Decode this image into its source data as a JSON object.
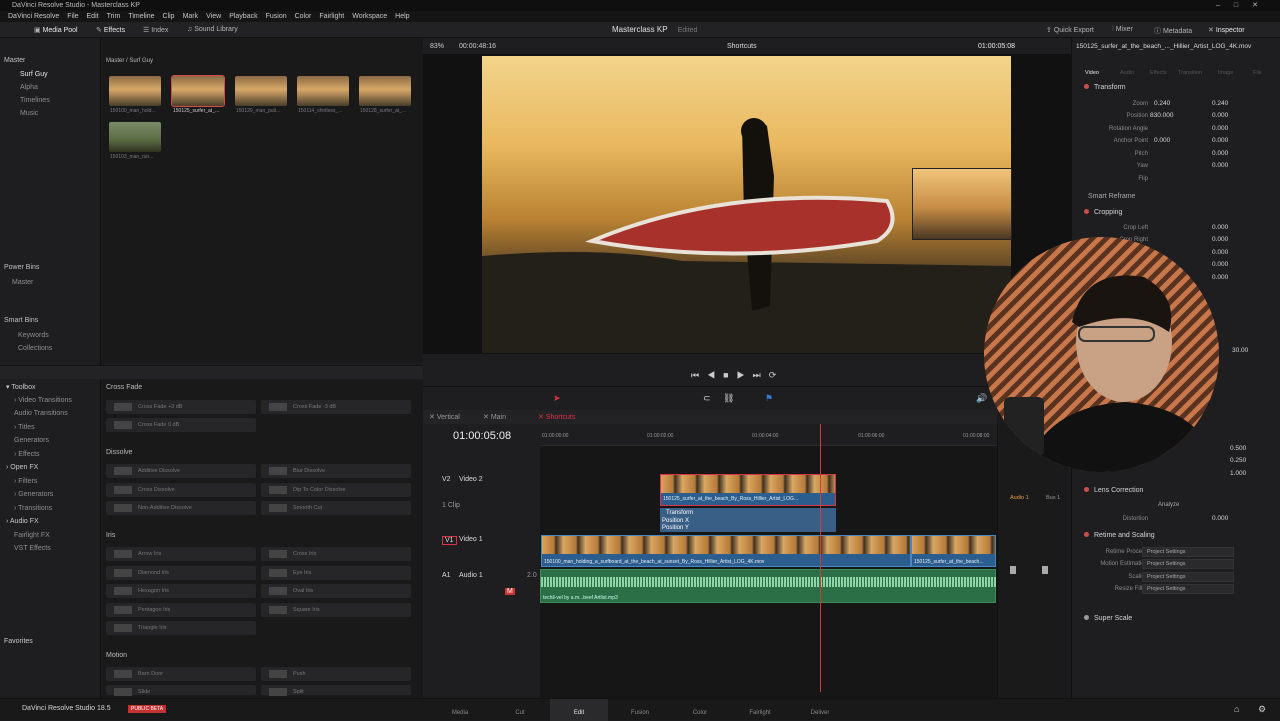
{
  "window": {
    "title": "DaVinci Resolve Studio - Masterclass KP"
  },
  "menu": [
    "DaVinci Resolve",
    "File",
    "Edit",
    "Trim",
    "Timeline",
    "Clip",
    "Mark",
    "View",
    "Playback",
    "Fusion",
    "Color",
    "Fairlight",
    "Workspace",
    "Help"
  ],
  "toolbar": {
    "media_pool": "Media Pool",
    "effects": "Effects",
    "index": "Index",
    "sound_library": "Sound Library",
    "project": "Masterclass KP",
    "status": "Edited",
    "quick_export": "Quick Export",
    "mixer": "Mixer",
    "metadata": "Metadata",
    "inspector": "Inspector"
  },
  "bins": {
    "master": "Master",
    "surf_guy": "Surf Guy",
    "alpha": "Alpha",
    "timelines": "Timelines",
    "music": "Music",
    "power_bins": "Power Bins",
    "power_master": "Master",
    "smart_bins": "Smart Bins",
    "keywords": "Keywords",
    "collections": "Collections"
  },
  "pool": {
    "path": "Master / Surf Guy",
    "clips": [
      "150100_man_hold...",
      "150125_surfer_at_...",
      "150129_man_putt...",
      "150114_shirtless_...",
      "150128_surfer_at_...",
      "150103_man_run..."
    ]
  },
  "effects_tree": {
    "toolbox": "Toolbox",
    "video_transitions": "Video Transitions",
    "audio_transitions": "Audio Transitions",
    "titles": "Titles",
    "generators": "Generators",
    "effects": "Effects",
    "open_fx": "Open FX",
    "filters": "Filters",
    "ofx_generators": "Generators",
    "transitions": "Transitions",
    "audio_fx": "Audio FX",
    "fairlight_fx": "Fairlight FX",
    "vst_effects": "VST Effects",
    "favorites": "Favorites"
  },
  "effects_list": {
    "cross_fade": "Cross Fade",
    "cf1": "Cross Fade +3 dB",
    "cf2": "Cross Fade -3 dB",
    "cf3": "Cross Fade 0 dB",
    "dissolve": "Dissolve",
    "d1": "Additive Dissolve",
    "d2": "Blur Dissolve",
    "d3": "Cross Dissolve",
    "d4": "Dip To Color Dissolve",
    "d5": "Non-Additive Dissolve",
    "d6": "Smooth Cut",
    "iris": "Iris",
    "i1": "Arrow Iris",
    "i2": "Cross Iris",
    "i3": "Diamond Iris",
    "i4": "Eye Iris",
    "i5": "Hexagon Iris",
    "i6": "Oval Iris",
    "i7": "Pentagon Iris",
    "i8": "Square Iris",
    "i9": "Triangle Iris",
    "motion": "Motion",
    "m1": "Barn Door",
    "m2": "Push",
    "m3": "Slide",
    "m4": "Split"
  },
  "viewer": {
    "zoom": "83%",
    "duration": "00:00:48:16",
    "mode": "Shortcuts",
    "timecode": "01:00:05:08"
  },
  "inspector": {
    "clip_name": "150125_surfer_at_the_beach_..._Hillier_Artist_LOG_4K.mov",
    "tabs": [
      "Video",
      "Audio",
      "Effects",
      "Transition",
      "Image",
      "File"
    ],
    "transform": "Transform",
    "zoom_label": "Zoom",
    "zoom_x": "0.240",
    "zoom_y": "0.240",
    "position_label": "Position",
    "pos_x": "830.000",
    "pos_y": "0.000",
    "rotation_label": "Rotation Angle",
    "rotation": "0.000",
    "anchor_label": "Anchor Point",
    "anchor_x": "0.000",
    "anchor_y": "0.000",
    "pitch_label": "Pitch",
    "pitch": "0.000",
    "yaw_label": "Yaw",
    "yaw": "0.000",
    "flip_label": "Flip",
    "smart_reframe": "Smart Reframe",
    "cropping": "Cropping",
    "crop_left_label": "Crop Left",
    "crop_left": "0.000",
    "crop_right_label": "Crop Right",
    "crop_right": "0.000",
    "crop_v3": "0.000",
    "crop_v4": "0.000",
    "crop_v5": "0.000",
    "v30": "30.00",
    "v500": "0.500",
    "v250": "0.250",
    "v1000": "1.000",
    "lens": "Lens Correction",
    "analyze": "Analyze",
    "distortion_label": "Distortion",
    "distortion": "0.000",
    "retime": "Retime and Scaling",
    "retime_process": "Retime Process",
    "motion_est": "Motion Estimation",
    "scaling": "Scaling",
    "resize_filter": "Resize Filter",
    "proj_settings": "Project Settings",
    "super_scale": "Super Scale"
  },
  "timeline": {
    "tab_vertical": "Vertical",
    "tab_main": "Main",
    "tab_shortcuts": "Shortcuts",
    "timecode": "01:00:05:08",
    "ruler": [
      "01:00:00:00",
      "01:00:02:00",
      "01:00:04:00",
      "01:00:06:00",
      "01:00:08:00"
    ],
    "v2": "V2",
    "v2_name": "Video 2",
    "v2_clips": "1 Clip",
    "v1": "V1",
    "v1_name": "Video 1",
    "a1": "A1",
    "a1_name": "Audio 1",
    "a1_ch": "2.0",
    "v2_clip": "150125_surfer_at_the_beach_By_Ross_Hillier_Artist_LOG...",
    "kf_transform": "Transform",
    "kf_posx": "Position X",
    "kf_posy": "Position Y",
    "v1_clip1": "150100_man_holding_a_surfboard_at_the_beach_at_sunset_By_Ross_Hillier_Artist_LOG_4K.mov",
    "v1_clip2": "150125_surfer_at_the_beach...",
    "a1_clip": "techil-vel by a.m...beef Artlist.mp3"
  },
  "mixer": {
    "audio1": "Audio 1",
    "bus1": "Bus 1"
  },
  "pages": [
    "Media",
    "Cut",
    "Edit",
    "Fusion",
    "Color",
    "Fairlight",
    "Deliver"
  ],
  "brand": {
    "name": "DaVinci Resolve Studio 18.5",
    "badge": "PUBLIC BETA"
  }
}
